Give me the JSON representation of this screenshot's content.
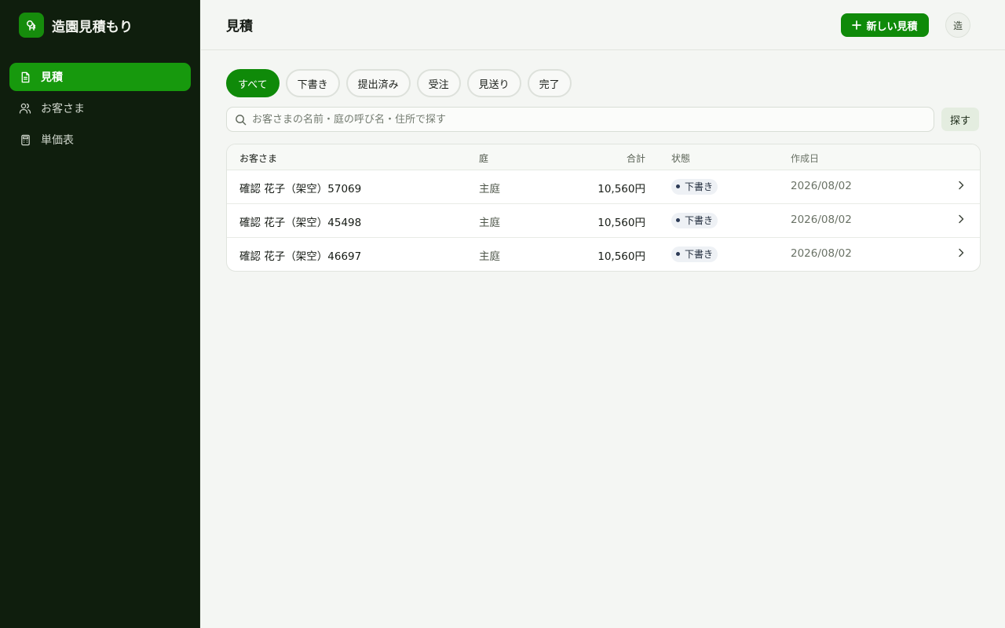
{
  "app": {
    "name": "造園見積もり"
  },
  "sidebar": {
    "items": [
      {
        "label": "見積",
        "icon": "document-icon",
        "active": true
      },
      {
        "label": "お客さま",
        "icon": "users-icon",
        "active": false
      },
      {
        "label": "単価表",
        "icon": "calculator-icon",
        "active": false
      }
    ]
  },
  "header": {
    "title": "見積",
    "new_button_label": "新しい見積",
    "avatar_text": "造"
  },
  "filters": [
    {
      "label": "すべて",
      "active": true
    },
    {
      "label": "下書き",
      "active": false
    },
    {
      "label": "提出済み",
      "active": false
    },
    {
      "label": "受注",
      "active": false
    },
    {
      "label": "見送り",
      "active": false
    },
    {
      "label": "完了",
      "active": false
    }
  ],
  "search": {
    "placeholder": "お客さまの名前・庭の呼び名・住所で探す",
    "value": "",
    "button_label": "探す"
  },
  "table": {
    "columns": {
      "customer": "お客さま",
      "garden": "庭",
      "total": "合計",
      "status": "状態",
      "created": "作成日"
    },
    "rows": [
      {
        "customer": "確認 花子（架空）57069",
        "garden": "主庭",
        "total": "10,560円",
        "status": "下書き",
        "created": "2026/08/02"
      },
      {
        "customer": "確認 花子（架空）45498",
        "garden": "主庭",
        "total": "10,560円",
        "status": "下書き",
        "created": "2026/08/02"
      },
      {
        "customer": "確認 花子（架空）46697",
        "garden": "主庭",
        "total": "10,560円",
        "status": "下書き",
        "created": "2026/08/02"
      }
    ]
  },
  "colors": {
    "sidebar_bg": "#0f1e0d",
    "accent": "#0f8a09",
    "active_nav": "#17990d",
    "page_bg": "#f4f6f3"
  }
}
